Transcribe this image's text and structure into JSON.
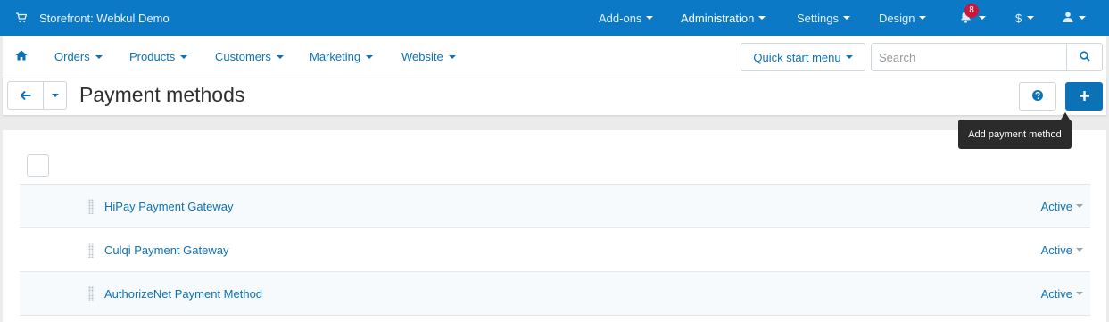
{
  "topbar": {
    "store_title": "Storefront: Webkul Demo",
    "menus": [
      {
        "label": "Add-ons"
      },
      {
        "label": "Administration"
      },
      {
        "label": "Settings"
      },
      {
        "label": "Design"
      }
    ],
    "notifications_count": "8",
    "currency_label": "$",
    "icons": {
      "store": "cart-icon",
      "notifications": "bell-icon",
      "user": "user-icon"
    }
  },
  "nav": {
    "items": [
      {
        "label": "Orders"
      },
      {
        "label": "Products"
      },
      {
        "label": "Customers"
      },
      {
        "label": "Marketing"
      },
      {
        "label": "Website"
      }
    ],
    "quick_start_label": "Quick start menu",
    "search": {
      "placeholder": "Search",
      "value": ""
    }
  },
  "header": {
    "title": "Payment methods",
    "icons": {
      "back": "arrow-left-icon",
      "help": "question-icon",
      "add": "plus-icon"
    }
  },
  "tooltip": {
    "text": "Add payment method"
  },
  "payment_methods": [
    {
      "name": "HiPay Payment Gateway",
      "status": "Active"
    },
    {
      "name": "Culqi Payment Gateway",
      "status": "Active"
    },
    {
      "name": "AuthorizeNet Payment Method",
      "status": "Active"
    }
  ],
  "colors": {
    "topbar": "#0c79c7",
    "accent": "#0b72b8",
    "badge": "#c8183b",
    "tooltip": "#2b2b2b"
  }
}
